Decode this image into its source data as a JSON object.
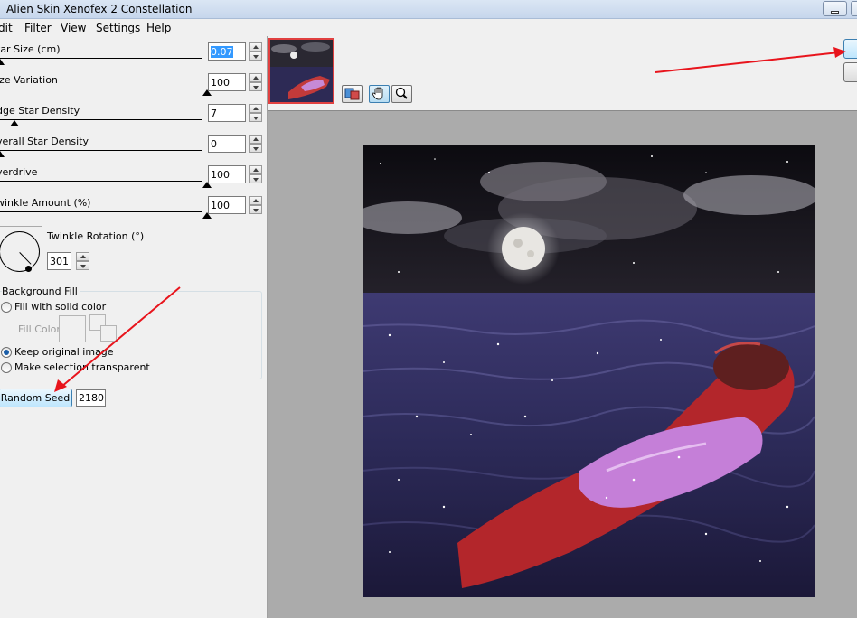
{
  "window": {
    "title": "Alien Skin Xenofex 2 Constellation"
  },
  "menu": [
    "dit",
    "Filter",
    "View",
    "Settings",
    "Help"
  ],
  "sliders": [
    {
      "label": "tar Size (cm)",
      "value": "0.07",
      "level": 0.0,
      "selected": true
    },
    {
      "label": "ize Variation",
      "value": "100",
      "level": 1.0
    },
    {
      "label": "dge Star Density",
      "value": "7",
      "level": 0.07
    },
    {
      "label": "verall Star Density",
      "value": "0",
      "level": 0.0
    },
    {
      "label": "verdrive",
      "value": "100",
      "level": 1.0
    },
    {
      "label": "winkle Amount (%)",
      "value": "100",
      "level": 1.0
    }
  ],
  "twinkle_rotation": {
    "label": "Twinkle Rotation (°)",
    "value": "301"
  },
  "background_fill": {
    "label": "Background Fill",
    "options": [
      {
        "label": "Fill with solid color",
        "checked": false
      },
      {
        "label": "Keep original image",
        "checked": true
      },
      {
        "label": "Make selection transparent",
        "checked": false
      }
    ],
    "fill_color_label": "Fill Color"
  },
  "seed": {
    "button_label": "Random Seed",
    "value": "2180"
  },
  "tools": [
    "preview-compare-icon",
    "hand-icon",
    "zoom-icon"
  ],
  "colors": {
    "annotation_arrow": "#e8141c",
    "thumb_border": "#e04040",
    "preview_bg": "#ababab"
  }
}
